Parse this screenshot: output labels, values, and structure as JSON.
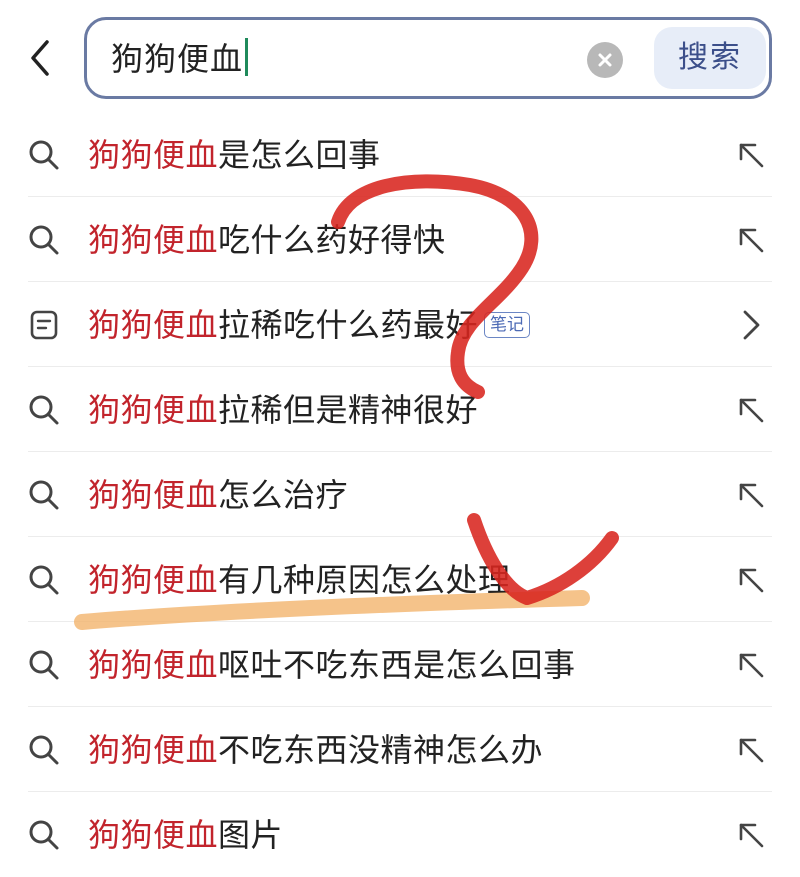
{
  "search": {
    "query": "狗狗便血",
    "submit_label": "搜索"
  },
  "icons": {
    "back": "chevron-left-icon",
    "clear": "clear-circle-x-icon",
    "suggestion": "search-icon",
    "note": "note-doc-icon",
    "fill": "arrow-up-left-icon",
    "open": "chevron-right-icon"
  },
  "colors": {
    "highlight": "#c2242c",
    "search_border": "#6a7aa3",
    "search_button_bg": "#e7edf8",
    "annotation_red": "#d8261f",
    "annotation_orange": "#f3b46d"
  },
  "suggestions": [
    {
      "highlight": "狗狗便血",
      "rest": "是怎么回事",
      "type": "search"
    },
    {
      "highlight": "狗狗便血",
      "rest": "吃什么药好得快",
      "type": "search"
    },
    {
      "highlight": "狗狗便血",
      "rest": "拉稀吃什么药最好",
      "type": "note",
      "badge": "笔记"
    },
    {
      "highlight": "狗狗便血",
      "rest": "拉稀但是精神很好",
      "type": "search"
    },
    {
      "highlight": "狗狗便血",
      "rest": "怎么治疗",
      "type": "search"
    },
    {
      "highlight": "狗狗便血",
      "rest": "有几种原因怎么处理",
      "type": "search"
    },
    {
      "highlight": "狗狗便血",
      "rest": "呕吐不吃东西是怎么回事",
      "type": "search"
    },
    {
      "highlight": "狗狗便血",
      "rest": "不吃东西没精神怎么办",
      "type": "search"
    },
    {
      "highlight": "狗狗便血",
      "rest": "图片",
      "type": "search"
    }
  ]
}
